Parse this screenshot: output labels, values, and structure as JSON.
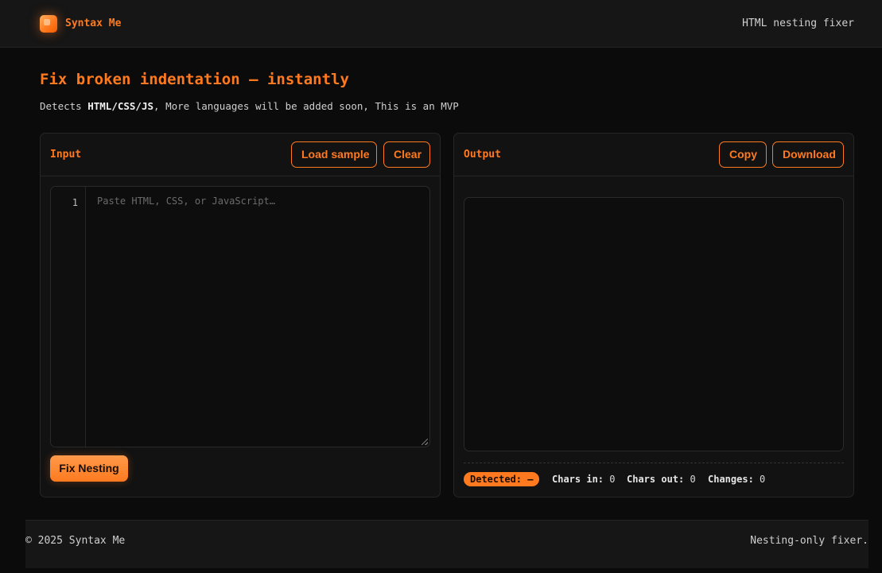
{
  "header": {
    "logo_icon": "brand-logo-icon",
    "brand": "Syntax Me",
    "tagline": "HTML nesting fixer"
  },
  "hero": {
    "title": "Fix broken indentation — instantly",
    "subtitle_prefix": "Detects ",
    "subtitle_bold": "HTML/CSS/JS",
    "subtitle_suffix": ", More languages will be added soon, This is an MVP"
  },
  "input_panel": {
    "title": "Input",
    "load_sample_label": "Load sample",
    "clear_label": "Clear",
    "line_number": "1",
    "placeholder": "Paste HTML, CSS, or JavaScript…",
    "fix_button_label": "Fix Nesting"
  },
  "output_panel": {
    "title": "Output",
    "copy_label": "Copy",
    "download_label": "Download",
    "detected_label": "Detected: —",
    "chars_in_label": "Chars in:",
    "chars_in_value": "0",
    "chars_out_label": "Chars out:",
    "chars_out_value": "0",
    "changes_label": "Changes:",
    "changes_value": "0"
  },
  "footer": {
    "copyright": "© 2025 Syntax Me",
    "note": "Nesting-only fixer."
  },
  "colors": {
    "accent": "#ff7a1f",
    "background": "#0b0b0b",
    "panel": "#121212"
  }
}
